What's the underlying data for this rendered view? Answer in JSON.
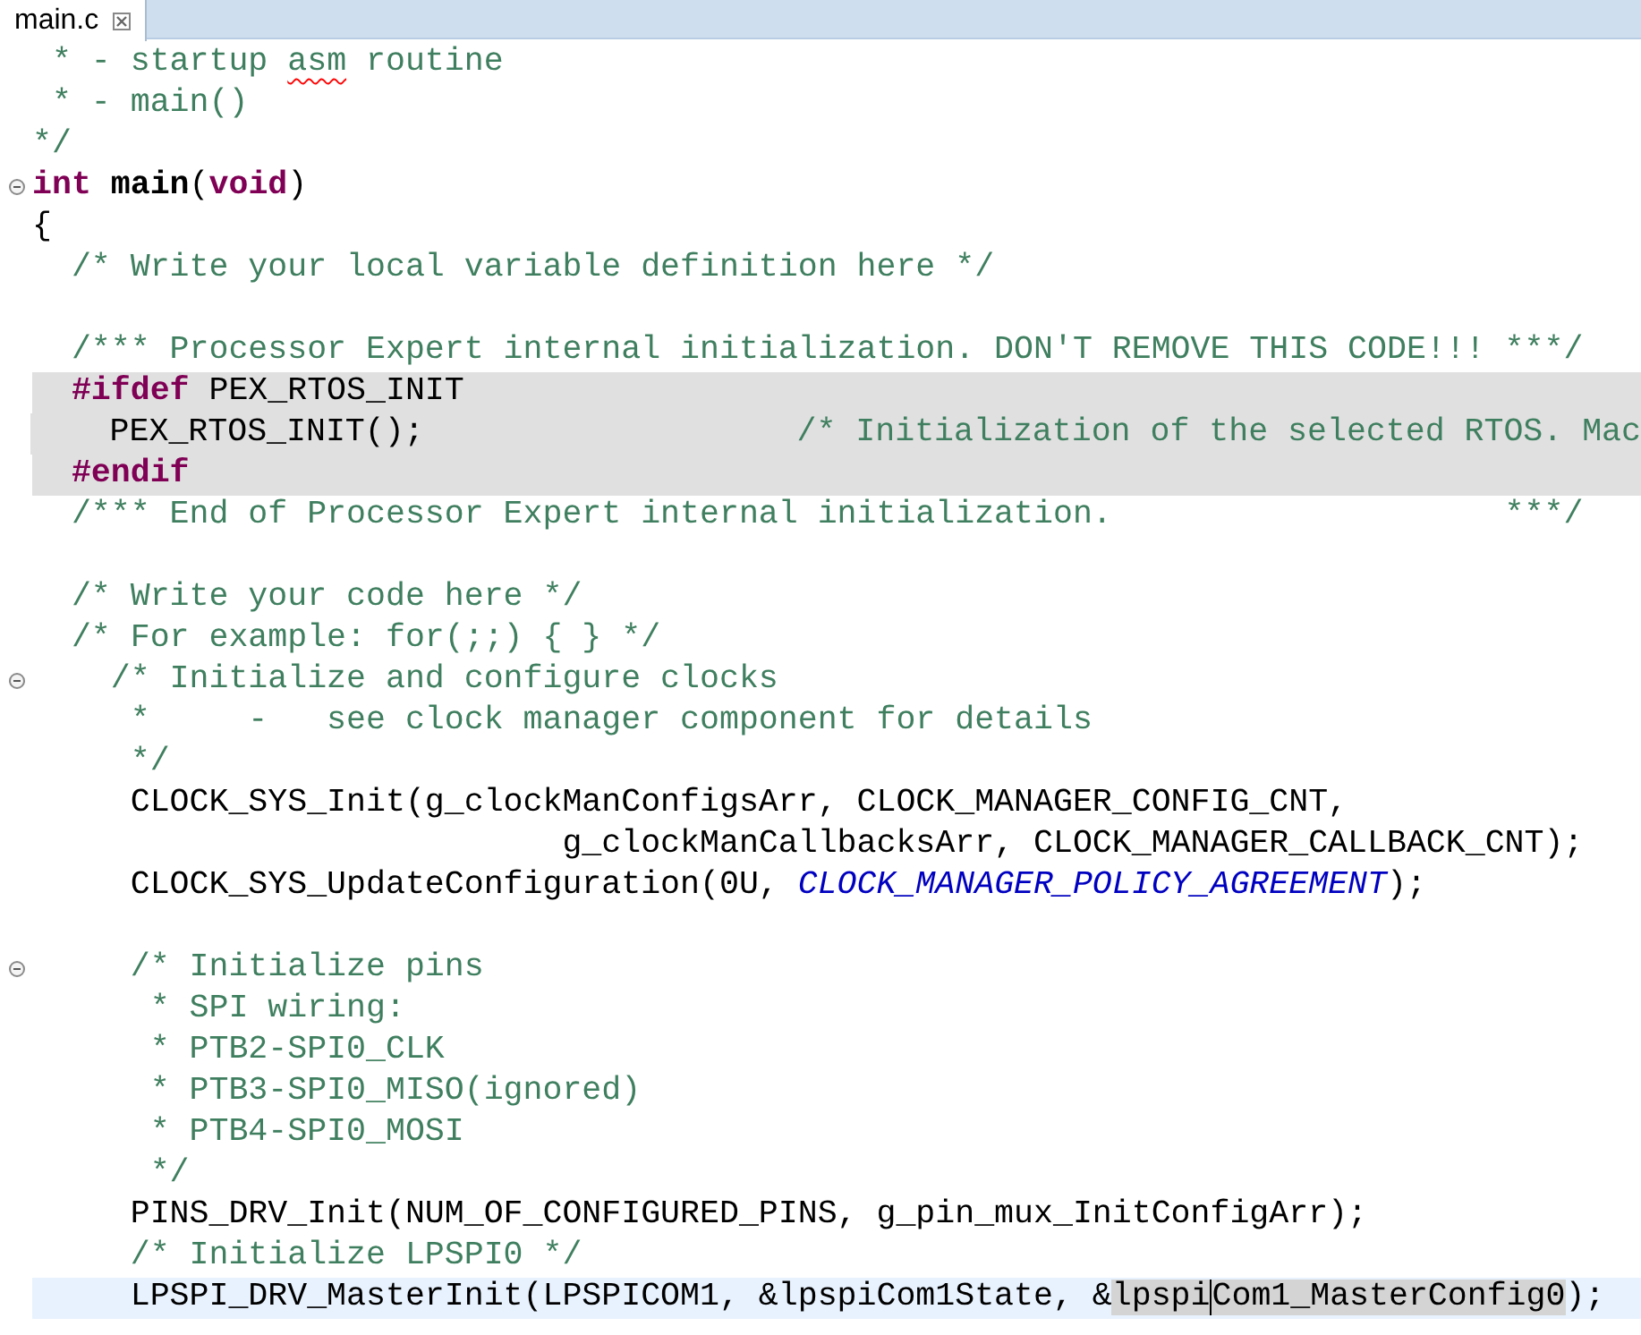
{
  "tab": {
    "title": "main.c",
    "selected": true
  },
  "lines": [
    {
      "segments": [
        {
          "kind": "comment",
          "text": " * - startup "
        },
        {
          "kind": "comment",
          "text": "asm",
          "misspelled": true
        },
        {
          "kind": "comment",
          "text": " routine"
        }
      ]
    },
    {
      "segments": [
        {
          "kind": "comment",
          "text": " * - main()"
        }
      ]
    },
    {
      "segments": [
        {
          "kind": "comment",
          "text": "*/"
        }
      ]
    },
    {
      "fold": true,
      "segments": [
        {
          "kind": "keyword",
          "text": "int"
        },
        {
          "kind": "bold",
          "text": " main"
        },
        {
          "kind": "plain",
          "text": "("
        },
        {
          "kind": "keyword",
          "text": "void"
        },
        {
          "kind": "plain",
          "text": ")"
        }
      ]
    },
    {
      "segments": [
        {
          "kind": "plain",
          "text": "{"
        }
      ]
    },
    {
      "segments": [
        {
          "kind": "comment",
          "text": "  /* Write your local variable definition here */"
        }
      ]
    },
    {
      "space_above": true,
      "segments": [
        {
          "kind": "comment",
          "text": "  /*** Processor Expert internal initialization. DON'T REMOVE THIS CODE!!! ***/"
        }
      ]
    },
    {
      "inactive": true,
      "segments": [
        {
          "kind": "keyword",
          "text": "  #ifdef"
        },
        {
          "kind": "plain",
          "text": " PEX_RTOS_INIT"
        }
      ]
    },
    {
      "inactive": true,
      "segments": [
        {
          "kind": "plain",
          "text": "    PEX_RTOS_INIT();                   "
        },
        {
          "kind": "comment",
          "text": "/* Initialization of the selected RTOS. Mac"
        }
      ]
    },
    {
      "inactive": true,
      "segments": [
        {
          "kind": "keyword",
          "text": "  #endif"
        }
      ]
    },
    {
      "segments": [
        {
          "kind": "comment",
          "text": "  /*** End of Processor Expert internal initialization.                    ***/"
        }
      ]
    },
    {
      "space_above": true,
      "segments": [
        {
          "kind": "comment",
          "text": "  /* Write your code here */"
        }
      ]
    },
    {
      "segments": [
        {
          "kind": "comment",
          "text": "  /* For example: for(;;) { } */"
        }
      ]
    },
    {
      "fold": true,
      "segments": [
        {
          "kind": "comment",
          "text": "    /* Initialize and configure clocks"
        }
      ]
    },
    {
      "segments": [
        {
          "kind": "comment",
          "text": "     *     -   see clock manager component for details"
        }
      ]
    },
    {
      "segments": [
        {
          "kind": "comment",
          "text": "     */"
        }
      ]
    },
    {
      "segments": [
        {
          "kind": "plain",
          "text": "     CLOCK_SYS_Init(g_clockManConfigsArr, CLOCK_MANAGER_CONFIG_CNT,"
        }
      ]
    },
    {
      "segments": [
        {
          "kind": "plain",
          "text": "                           g_clockManCallbacksArr, CLOCK_MANAGER_CALLBACK_CNT);"
        }
      ]
    },
    {
      "segments": [
        {
          "kind": "plain",
          "text": "     CLOCK_SYS_UpdateConfiguration(0U, "
        },
        {
          "kind": "macro",
          "text": "CLOCK_MANAGER_POLICY_AGREEMENT"
        },
        {
          "kind": "plain",
          "text": ");"
        }
      ]
    },
    {
      "space_above": true,
      "fold": true,
      "segments": [
        {
          "kind": "comment",
          "text": "     /* Initialize pins"
        }
      ]
    },
    {
      "segments": [
        {
          "kind": "comment",
          "text": "      * SPI wiring:"
        }
      ]
    },
    {
      "segments": [
        {
          "kind": "comment",
          "text": "      * PTB2-SPI0_CLK"
        }
      ]
    },
    {
      "segments": [
        {
          "kind": "comment",
          "text": "      * PTB3-SPI0_MISO(ignored)"
        }
      ]
    },
    {
      "segments": [
        {
          "kind": "comment",
          "text": "      * PTB4-SPI0_MOSI"
        }
      ]
    },
    {
      "segments": [
        {
          "kind": "comment",
          "text": "      */"
        }
      ]
    },
    {
      "segments": [
        {
          "kind": "plain",
          "text": "     PINS_DRV_Init(NUM_OF_CONFIGURED_PINS, g_pin_mux_InitConfigArr);"
        }
      ]
    },
    {
      "segments": [
        {
          "kind": "comment",
          "text": "     /* Initialize LPSPI0 */"
        }
      ]
    },
    {
      "current": true,
      "segments": [
        {
          "kind": "plain",
          "text": "     LPSPI_DRV_MasterInit(LPSPICOM1, &lpspiCom1State, &"
        },
        {
          "kind": "plain",
          "text": "lpspi",
          "selected": true
        },
        {
          "kind": "plain",
          "text": "Com1_MasterConfig0",
          "selected": true,
          "cursor": true
        },
        {
          "kind": "plain",
          "text": ");"
        }
      ]
    }
  ]
}
